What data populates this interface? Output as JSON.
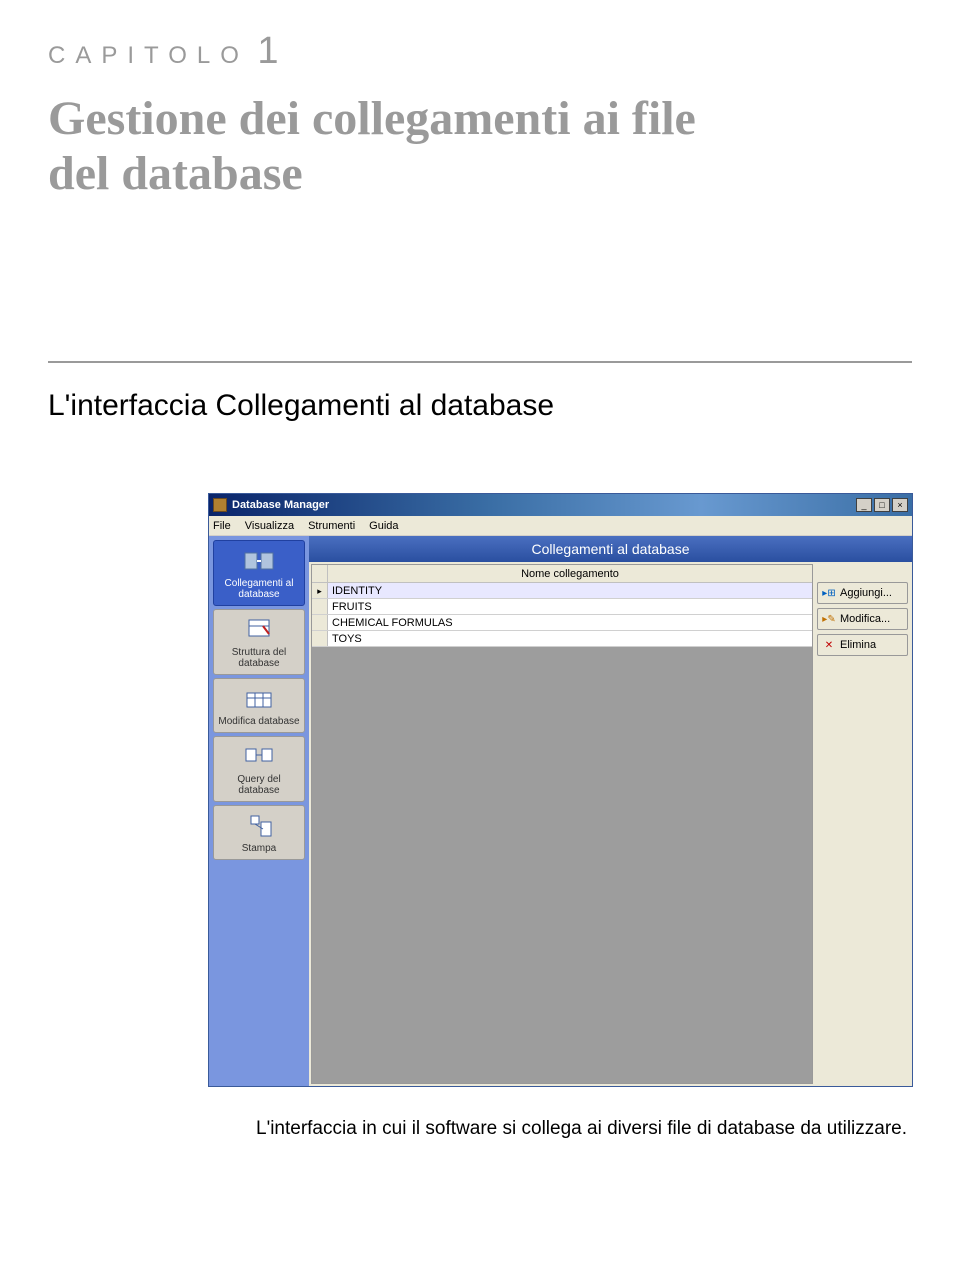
{
  "doc": {
    "chapter_label": "CAPITOLO",
    "chapter_num": "1",
    "title_line1": "Gestione dei collegamenti ai file",
    "title_line2": "del database",
    "section_title": "L'interfaccia Collegamenti al database",
    "caption": "L'interfaccia in cui il software si collega ai diversi file di database da utilizzare."
  },
  "screenshot": {
    "window_title": "Database Manager",
    "win_min": "_",
    "win_max": "□",
    "win_close": "×",
    "menus": [
      "File",
      "Visualizza",
      "Strumenti",
      "Guida"
    ],
    "sidebar": {
      "items": [
        {
          "label": "Collegamenti al database",
          "selected": true
        },
        {
          "label": "Struttura del database",
          "selected": false
        },
        {
          "label": "Modifica database",
          "selected": false
        },
        {
          "label": "Query del database",
          "selected": false
        },
        {
          "label": "Stampa",
          "selected": false
        }
      ]
    },
    "main": {
      "header": "Collegamenti al database",
      "column_header": "Nome collegamento",
      "row_marker": "▸",
      "rows": [
        "IDENTITY",
        "FRUITS",
        "CHEMICAL FORMULAS",
        "TOYS"
      ],
      "actions": {
        "add": "Aggiungi...",
        "modify": "Modifica...",
        "delete": "Elimina"
      },
      "icons": {
        "add": "▸⊞",
        "modify": "▸✎",
        "delete": "✕"
      }
    }
  }
}
